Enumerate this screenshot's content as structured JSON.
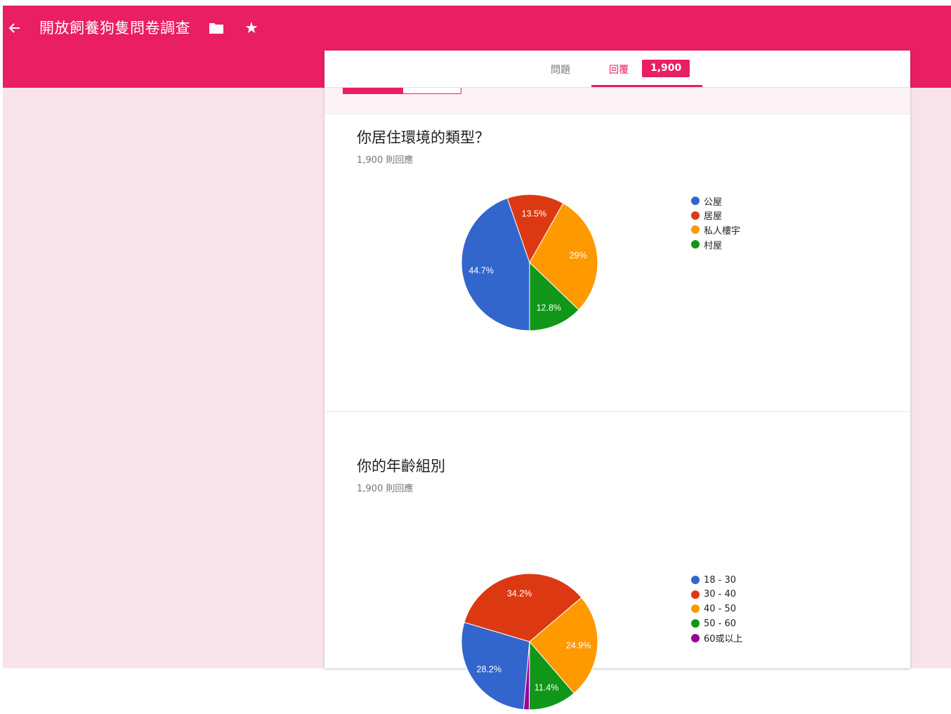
{
  "header": {
    "title": "開放飼養狗隻問卷調查",
    "color": "#e91e63",
    "icons": [
      "arrow-back-icon",
      "folder-icon",
      "star-icon"
    ]
  },
  "tabs": {
    "questions_label": "問題",
    "responses_label": "回覆",
    "response_count": "1,900"
  },
  "questions": [
    {
      "title": "你居住環境的類型？",
      "count_text": "1,900 則回應",
      "chart_data": {
        "type": "pie",
        "categories": [
          "公屋",
          "居屋",
          "私人樓宇",
          "村屋"
        ],
        "values": [
          44.7,
          13.5,
          29,
          12.8
        ],
        "labels": [
          "44.7%",
          "13.5%",
          "29%",
          "12.8%"
        ],
        "colors": [
          "#3366cc",
          "#dc3912",
          "#ff9900",
          "#109618"
        ],
        "legend": "right"
      }
    },
    {
      "title": "你的年齡組別",
      "count_text": "1,900 則回應",
      "chart_data": {
        "type": "pie",
        "categories": [
          "18 - 30",
          "30 - 40",
          "40 - 50",
          "50 - 60",
          "60或以上"
        ],
        "values": [
          28.2,
          34.2,
          24.9,
          11.4,
          1.3
        ],
        "labels": [
          "28.2%",
          "34.2%",
          "24.9%",
          "11.4%",
          ""
        ],
        "colors": [
          "#3366cc",
          "#dc3912",
          "#ff9900",
          "#109618",
          "#990099"
        ],
        "legend": "right"
      }
    }
  ]
}
